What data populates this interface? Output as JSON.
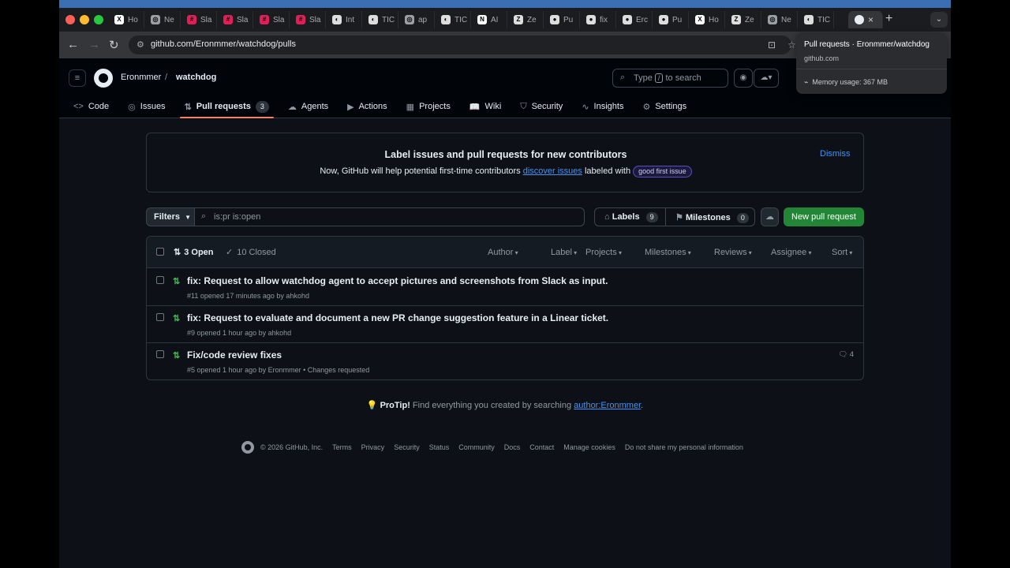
{
  "browser": {
    "tabs": [
      {
        "label": "Ho",
        "icon": "x-icon"
      },
      {
        "label": "Ne",
        "icon": "chrome-icon"
      },
      {
        "label": "Sla",
        "icon": "slack-icon"
      },
      {
        "label": "Sla",
        "icon": "slack-icon"
      },
      {
        "label": "Sla",
        "icon": "slack-icon"
      },
      {
        "label": "Sla",
        "icon": "slack-icon"
      },
      {
        "label": "Int",
        "icon": "openai-icon"
      },
      {
        "label": "TIC",
        "icon": "openai-icon"
      },
      {
        "label": "ap",
        "icon": "chrome-icon"
      },
      {
        "label": "TIC",
        "icon": "openai-icon"
      },
      {
        "label": "AI",
        "icon": "notion-icon"
      },
      {
        "label": "Ze",
        "icon": "zed-icon"
      },
      {
        "label": "Pu",
        "icon": "github-icon"
      },
      {
        "label": "fix",
        "icon": "github-icon"
      },
      {
        "label": "Erc",
        "icon": "github-icon"
      },
      {
        "label": "Pu",
        "icon": "github-icon"
      },
      {
        "label": "Ho",
        "icon": "x-icon"
      },
      {
        "label": "Ze",
        "icon": "zed-icon"
      },
      {
        "label": "Ne",
        "icon": "chrome-icon"
      },
      {
        "label": "TIC",
        "icon": "openai-icon"
      }
    ],
    "active_tab_close": "×",
    "new_tab": "+",
    "url": "github.com/Eronmmer/watchdog/pulls",
    "tooltip": {
      "title": "Pull requests · Eronmmer/watchdog",
      "domain": "github.com",
      "memory": "Memory usage: 367 MB"
    }
  },
  "header": {
    "owner": "Eronmmer",
    "separator": "/",
    "repo": "watchdog",
    "search_prefix": "Type",
    "search_key": "/",
    "search_suffix": "to search"
  },
  "repo_nav": [
    {
      "label": "Code",
      "icon": "<>"
    },
    {
      "label": "Issues",
      "icon": "◎"
    },
    {
      "label": "Pull requests",
      "icon": "⇅",
      "count": "3",
      "selected": true
    },
    {
      "label": "Agents",
      "icon": "☁"
    },
    {
      "label": "Actions",
      "icon": "▶"
    },
    {
      "label": "Projects",
      "icon": "▦"
    },
    {
      "label": "Wiki",
      "icon": "📖"
    },
    {
      "label": "Security",
      "icon": "⛉"
    },
    {
      "label": "Insights",
      "icon": "∿"
    },
    {
      "label": "Settings",
      "icon": "⚙"
    }
  ],
  "banner": {
    "title": "Label issues and pull requests for new contributors",
    "text_before": "Now, GitHub will help potential first-time contributors",
    "link": "discover issues",
    "text_after": "labeled with",
    "label": "good first issue",
    "dismiss": "Dismiss"
  },
  "filters": {
    "button": "Filters",
    "query": "is:pr is:open",
    "labels": "Labels",
    "labels_count": "9",
    "milestones": "Milestones",
    "milestones_count": "0",
    "new_pr": "New pull request"
  },
  "list": {
    "open": "3 Open",
    "closed": "10 Closed",
    "header_filters": [
      "Author",
      "Label",
      "Projects",
      "Milestones",
      "Reviews",
      "Assignee",
      "Sort"
    ],
    "rows": [
      {
        "title": "fix: Request to allow watchdog agent to accept pictures and screenshots from Slack as input.",
        "meta": "#11 opened 17 minutes ago by ahkohd",
        "comments": ""
      },
      {
        "title": "fix: Request to evaluate and document a new PR change suggestion feature in a Linear ticket.",
        "meta": "#9 opened 1 hour ago by ahkohd",
        "comments": ""
      },
      {
        "title": "Fix/code review fixes",
        "meta": "#5 opened 1 hour ago by Eronmmer • Changes requested",
        "comments": "4"
      }
    ]
  },
  "protip": {
    "bold": "ProTip!",
    "text": "Find everything you created by searching",
    "link": "author:Eronmmer",
    "end": "."
  },
  "footer": {
    "copyright": "© 2026 GitHub, Inc.",
    "links": [
      "Terms",
      "Privacy",
      "Security",
      "Status",
      "Community",
      "Docs",
      "Contact",
      "Manage cookies",
      "Do not share my personal information"
    ]
  },
  "colors": {
    "accent_link": "#4493f8",
    "primary_button": "#238636",
    "pr_open": "#3fb950",
    "selected_underline": "#f78166"
  }
}
